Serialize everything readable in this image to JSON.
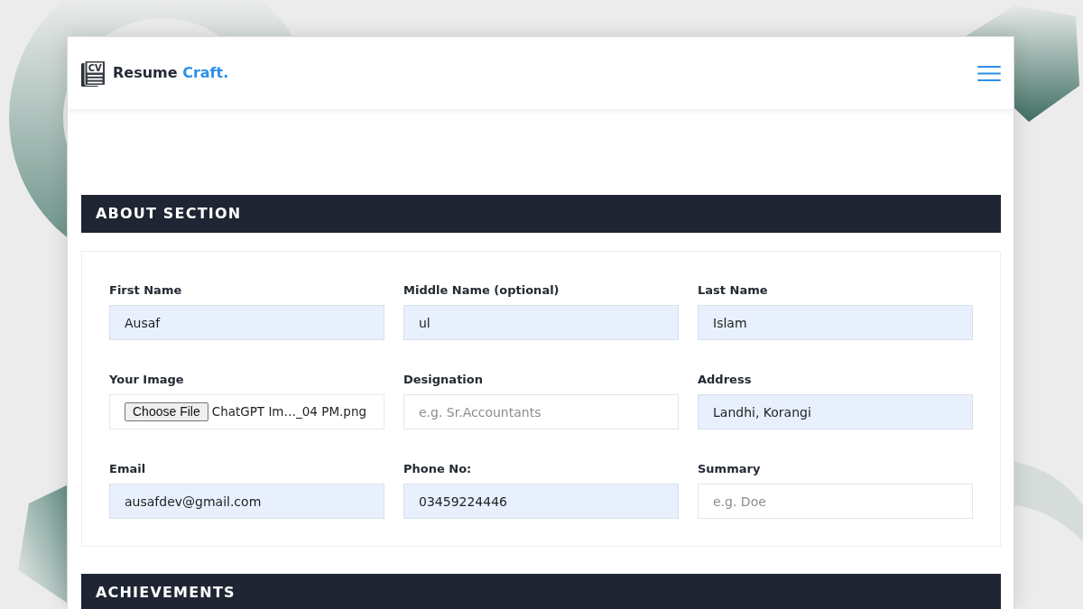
{
  "header": {
    "logo_badge": "CV",
    "brand": {
      "text": "Resume",
      "accent": "Craft."
    }
  },
  "sections": [
    {
      "title": "ABOUT SECTION",
      "fields": [
        {
          "kind": "text",
          "label": "First Name",
          "value": "Ausaf",
          "autofilled": true
        },
        {
          "kind": "text",
          "label": "Middle Name (optional)",
          "value": "ul",
          "autofilled": true
        },
        {
          "kind": "text",
          "label": "Last Name",
          "value": "Islam",
          "autofilled": true
        },
        {
          "kind": "file",
          "label": "Your Image",
          "button": "Choose File",
          "file_name": "ChatGPT Im…_04 PM.png"
        },
        {
          "kind": "text",
          "label": "Designation",
          "placeholder": "e.g. Sr.Accountants",
          "autofilled": false
        },
        {
          "kind": "text",
          "label": "Address",
          "value": "Landhi, Korangi",
          "autofilled": true
        },
        {
          "kind": "text",
          "label": "Email",
          "value": "ausafdev@gmail.com",
          "autofilled": true
        },
        {
          "kind": "text",
          "label": "Phone No:",
          "value": "03459224446",
          "autofilled": true
        },
        {
          "kind": "text",
          "label": "Summary",
          "placeholder": "e.g. Doe",
          "autofilled": false
        }
      ]
    },
    {
      "title": "ACHIEVEMENTS"
    }
  ]
}
